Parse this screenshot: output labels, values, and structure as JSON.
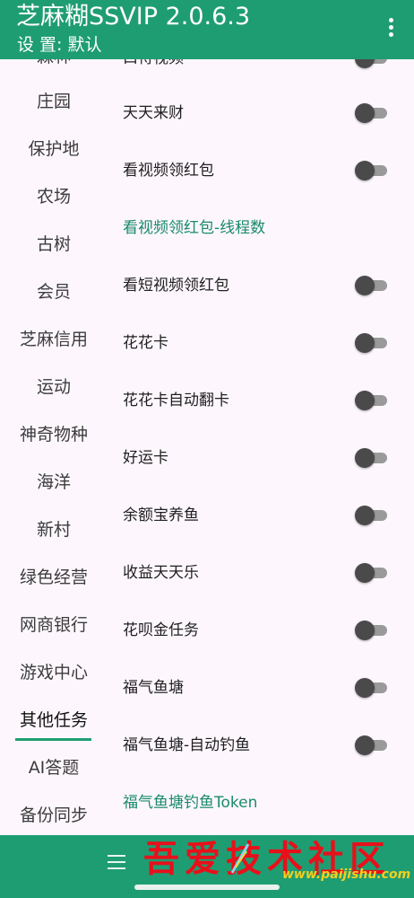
{
  "app_bar": {
    "title": "芝麻糊SSVIP 2.0.6.3",
    "subtitle": "设 置: 默认",
    "menu_icon": "more-vert-icon"
  },
  "sidebar": {
    "partial_top": "森林",
    "items": [
      {
        "label": "庄园"
      },
      {
        "label": "保护地"
      },
      {
        "label": "农场"
      },
      {
        "label": "古树"
      },
      {
        "label": "会员"
      },
      {
        "label": "芝麻信用"
      },
      {
        "label": "运动"
      },
      {
        "label": "神奇物种"
      },
      {
        "label": "海洋"
      },
      {
        "label": "新村"
      },
      {
        "label": "绿色经营"
      },
      {
        "label": "网商银行"
      },
      {
        "label": "游戏中心"
      },
      {
        "label": "其他任务",
        "selected": true
      },
      {
        "label": "AI答题"
      },
      {
        "label": "备份同步"
      }
    ]
  },
  "content": {
    "partial_top": "口待视频",
    "settings": [
      {
        "label": "天天来财",
        "type": "toggle",
        "on": false
      },
      {
        "label": "看视频领红包",
        "type": "toggle",
        "on": false
      },
      {
        "label": "看视频领红包-线程数",
        "type": "link"
      },
      {
        "label": "看短视频领红包",
        "type": "toggle",
        "on": false
      },
      {
        "label": "花花卡",
        "type": "toggle",
        "on": false
      },
      {
        "label": "花花卡自动翻卡",
        "type": "toggle",
        "on": false
      },
      {
        "label": "好运卡",
        "type": "toggle",
        "on": false
      },
      {
        "label": "余额宝养鱼",
        "type": "toggle",
        "on": false
      },
      {
        "label": "收益天天乐",
        "type": "toggle",
        "on": false
      },
      {
        "label": "花呗金任务",
        "type": "toggle",
        "on": false
      },
      {
        "label": "福气鱼塘",
        "type": "toggle",
        "on": false
      },
      {
        "label": "福气鱼塘-自动钓鱼",
        "type": "toggle",
        "on": false
      },
      {
        "label": "福气鱼塘钓鱼Token",
        "type": "link"
      }
    ]
  },
  "bottom_bar": {
    "menu_icon": "hamburger-icon"
  },
  "watermark": {
    "text": "吾爱技术社区",
    "url": "www.paijishu.com"
  },
  "colors": {
    "primary": "#1f9d72",
    "background": "#fdf7fd",
    "link_text": "#1a8a6a",
    "watermark_red": "#e8101a"
  }
}
